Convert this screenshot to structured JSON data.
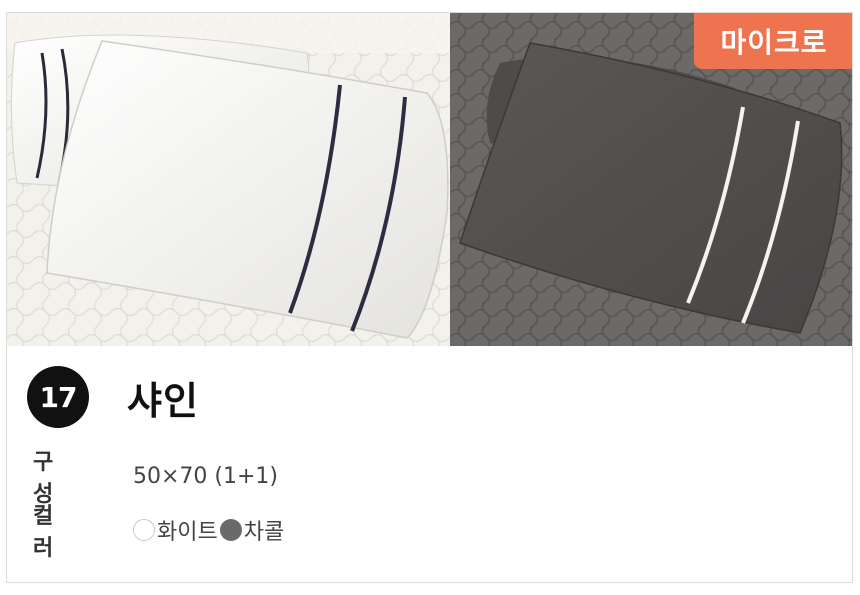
{
  "badge": "마이크로",
  "product": {
    "number": "17",
    "name": "샤인"
  },
  "specs": [
    {
      "label": "구 성",
      "value": "50×70 (1+1)"
    },
    {
      "label": "컬 러",
      "colors": [
        {
          "name": "화이트",
          "hex": "#ffffff"
        },
        {
          "name": "차콜",
          "hex": "#6a6a6a"
        }
      ]
    }
  ],
  "photos": {
    "left": {
      "icon": "white-pillow-photo"
    },
    "right": {
      "icon": "charcoal-pillow-photo"
    }
  }
}
